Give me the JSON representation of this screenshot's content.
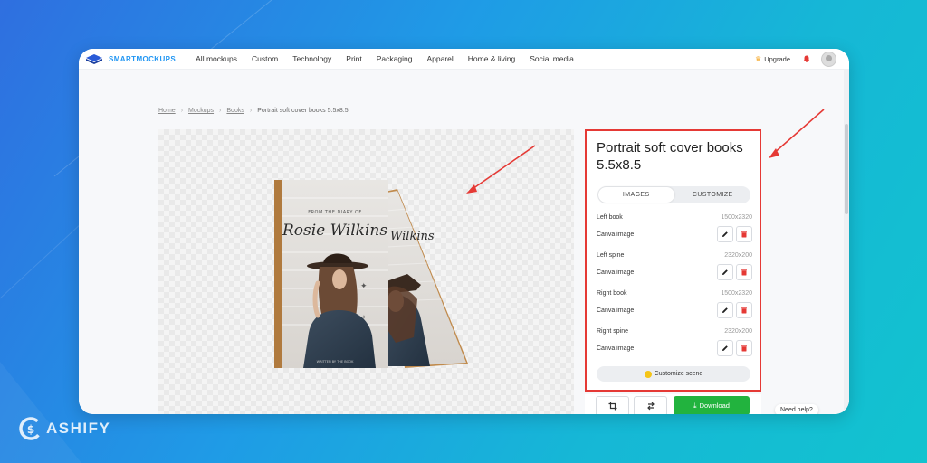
{
  "app": {
    "logo_text": "SMARTMOCKUPS"
  },
  "nav": {
    "items": [
      "All mockups",
      "Custom",
      "Technology",
      "Print",
      "Packaging",
      "Apparel",
      "Home & living",
      "Social media"
    ],
    "upgrade_label": "Upgrade"
  },
  "breadcrumb": {
    "home": "Home",
    "mockups": "Mockups",
    "books": "Books",
    "current": "Portrait soft cover books 5.5x8.5"
  },
  "preview": {
    "book_small_text": "FROM THE DIARY OF",
    "book_title": "Rosie Wilkins",
    "book_footer": "WRITTEN BY THE BOOK"
  },
  "panel": {
    "title": "Portrait soft cover books 5.5x8.5",
    "tabs": [
      {
        "label": "IMAGES",
        "active": true
      },
      {
        "label": "CUSTOMIZE",
        "active": false
      }
    ],
    "layers": [
      {
        "name": "Left book",
        "size": "1500x2320",
        "source": "Canva image"
      },
      {
        "name": "Left spine",
        "size": "2320x200",
        "source": "Canva image"
      },
      {
        "name": "Right book",
        "size": "1500x2320",
        "source": "Canva image"
      },
      {
        "name": "Right spine",
        "size": "2320x200",
        "source": "Canva image"
      }
    ],
    "customize_scene_label": "Customize scene"
  },
  "actions": {
    "download_label": "Download"
  },
  "help": {
    "label": "Need help?"
  },
  "watermark": {
    "text": "ASHIFY"
  },
  "colors": {
    "brand_blue": "#2196f3",
    "highlight_red": "#e53935",
    "download_green": "#22b33e"
  }
}
